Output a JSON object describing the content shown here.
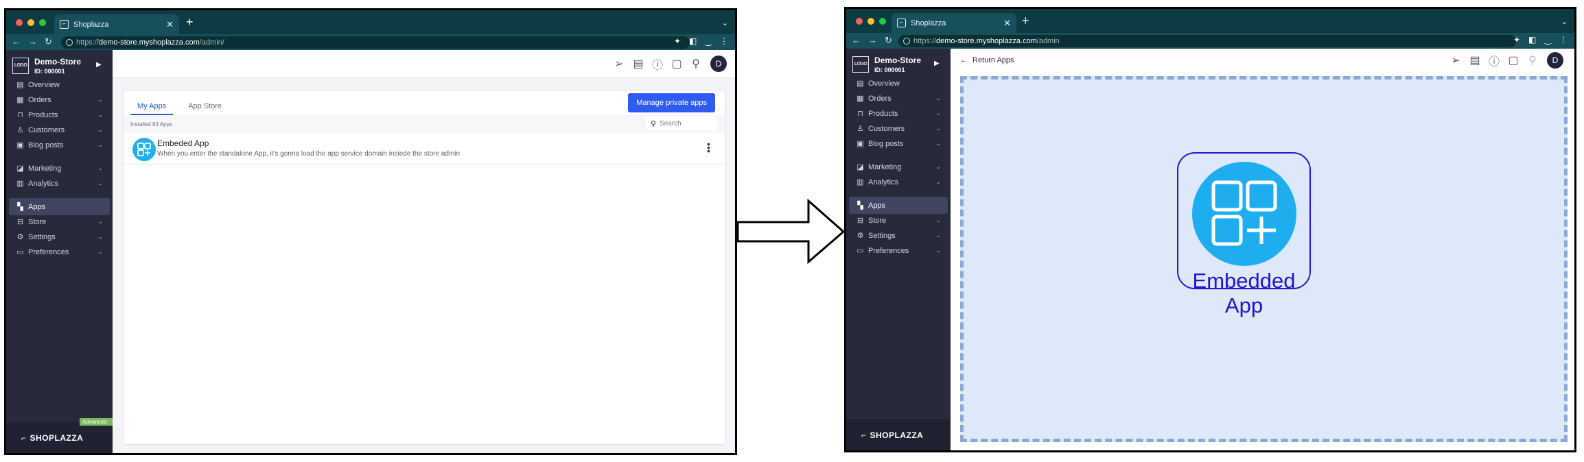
{
  "browser": {
    "tab_title": "Shoplazza",
    "url_left_prefix": "https://",
    "url_left_host": "demo-store.myshoplazza.com",
    "url_left_path": "/admin/",
    "url_right_prefix": "https://",
    "url_right_host": "demo-store.myshoplazza.com",
    "url_right_path": "/admin",
    "new_tab": "+",
    "close_tab": "✕"
  },
  "store": {
    "logo": "LOGO",
    "name": "Demo-Store",
    "id": "ID: 000001"
  },
  "sidebar": {
    "items": [
      {
        "label": "Overview",
        "icon": "overview-icon"
      },
      {
        "label": "Orders",
        "icon": "orders-icon"
      },
      {
        "label": "Products",
        "icon": "products-icon"
      },
      {
        "label": "Customers",
        "icon": "customers-icon"
      },
      {
        "label": "Blog posts",
        "icon": "blog-icon"
      },
      {
        "label": "Marketing",
        "icon": "marketing-icon"
      },
      {
        "label": "Analytics",
        "icon": "analytics-icon"
      },
      {
        "label": "Apps",
        "icon": "apps-icon"
      },
      {
        "label": "Store",
        "icon": "store-icon"
      },
      {
        "label": "Settings",
        "icon": "settings-icon"
      },
      {
        "label": "Preferences",
        "icon": "preferences-icon"
      }
    ],
    "footer_brand": "SHOPLAZZA",
    "advanced_badge": "Advanced :"
  },
  "topbar": {
    "avatar": "D",
    "return_label": "Return Apps"
  },
  "apps_page": {
    "tabs": [
      "My Apps",
      "App Store"
    ],
    "manage_button": "Manage private apps",
    "installed": "Installed 83 Apps",
    "search_placeholder": "Search",
    "app_name": "Embeded App",
    "app_desc": "When you enter the standalone App, it's gonna load the app service domain insiede the store admin"
  },
  "embedded": {
    "title": "Embedded App"
  },
  "colors": {
    "sidebar_bg": "#262a3b",
    "chrome_bg": "#0d3b44",
    "primary": "#2e5cf0",
    "app_icon": "#1eaef0",
    "embedded_text": "#1f14d4"
  }
}
